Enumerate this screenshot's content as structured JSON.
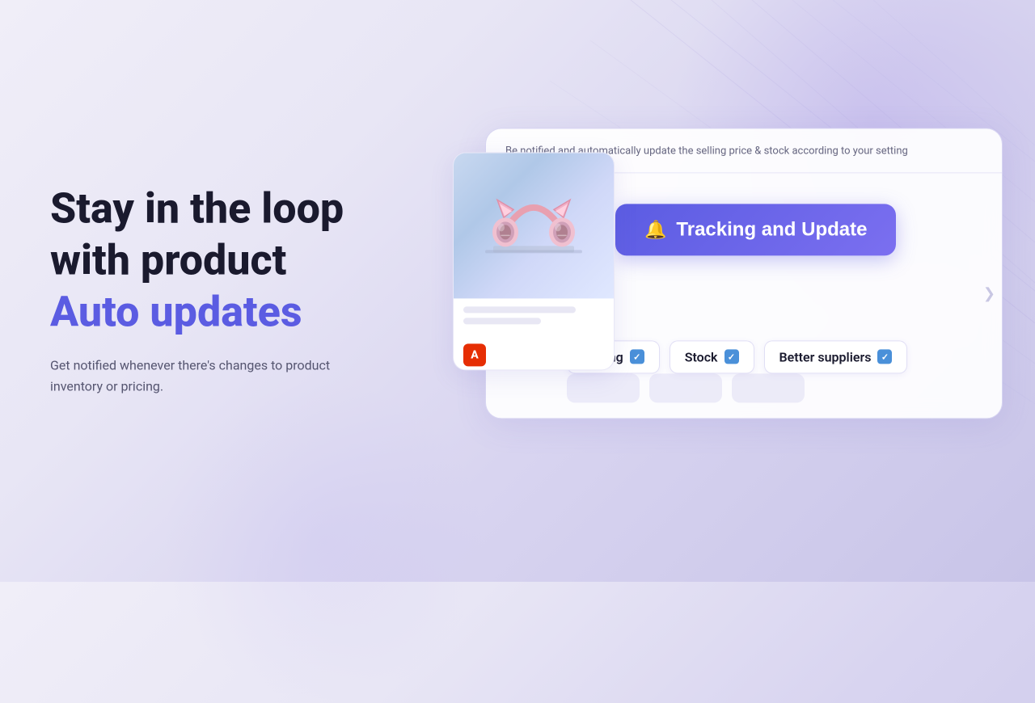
{
  "background": {
    "gradient_start": "#f0eef8",
    "gradient_end": "#c8c4e8"
  },
  "left": {
    "headline_line1": "Stay in the loop",
    "headline_line2": "with product",
    "headline_accent": "Auto updates",
    "subtext": "Get notified whenever there's changes to product inventory or pricing."
  },
  "card": {
    "header_text": "Be notified and automatically update the selling price & stock according to your setting",
    "tracking_button_label": "Tracking and Update",
    "tracking_button_icon": "🔔",
    "tags": [
      {
        "label": "Pricing",
        "checked": true
      },
      {
        "label": "Stock",
        "checked": true
      },
      {
        "label": "Better suppliers",
        "checked": true
      }
    ]
  },
  "product": {
    "ali_logo": "A"
  },
  "icons": {
    "bell": "🔔",
    "check": "✓"
  }
}
